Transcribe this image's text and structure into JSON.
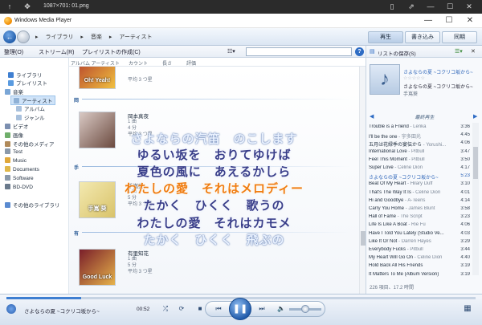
{
  "viewer": {
    "title": "1087×701: 01.png"
  },
  "app": {
    "title": "Windows Media Player",
    "min": "—",
    "max": "☐",
    "close": "✕"
  },
  "nav": {
    "crumbs": [
      "ライブラリ",
      "音楽",
      "アーティスト"
    ],
    "tabs": [
      "再生",
      "書き込み",
      "同期"
    ]
  },
  "toolbar": {
    "organize": "整理(O)",
    "stream": "ストリーム(R)",
    "create_playlist": "プレイリストの作成(C)",
    "search_placeholder": "",
    "help": "?"
  },
  "columns": [
    "アルバム アーティスト",
    "カウント",
    "長さ",
    "評価"
  ],
  "sidebar": [
    {
      "label": "ライブラリ",
      "color": "#3f7fd1"
    },
    {
      "label": "プレイリスト",
      "color": "#5a9be0"
    },
    {
      "label": "音楽",
      "color": "#7aa6d6"
    },
    {
      "label": "アーティスト",
      "color": "#8fb1d6",
      "selected": true
    },
    {
      "label": "アルバム",
      "color": "#a9c1dd"
    },
    {
      "label": "ジャンル",
      "color": "#a9c1dd"
    },
    {
      "label": "ビデオ",
      "color": "#7b8fb0"
    },
    {
      "label": "画像",
      "color": "#6fae6a"
    },
    {
      "label": "その他のメディア",
      "color": "#b08a5a"
    },
    {
      "label": "Test",
      "color": "#8a99aa"
    },
    {
      "label": "Music",
      "color": "#e0a83a"
    },
    {
      "label": "Documents",
      "color": "#e0b84a"
    },
    {
      "label": "Software",
      "color": "#8a99aa"
    },
    {
      "label": "BD-DVD",
      "color": "#6a7a8c"
    },
    {
      "label": "その他のライブラリ",
      "color": "#5a8ad0"
    }
  ],
  "artists": [
    {
      "name": "",
      "meta1": "平均 3 つ星",
      "meta2": "",
      "meta3": "",
      "colors": [
        "#b23a2a",
        "#f0c040"
      ],
      "text": "Oh! Yeah!"
    },
    {
      "name": "岡本真夜",
      "meta1": "1 曲",
      "meta2": "4 分",
      "meta3": "平均 3 つ星",
      "colors": [
        "#d9c9c4",
        "#6b4a3f"
      ],
      "text": ""
    },
    {
      "name": "手嶌葵",
      "meta1": "1 曲",
      "meta2": "5 分",
      "meta3": "平均 3 つ星",
      "colors": [
        "#f3e9b0",
        "#d9c36a"
      ],
      "text": "手嶌 葵"
    },
    {
      "name": "有里知花",
      "meta1": "1 曲",
      "meta2": "5 分",
      "meta3": "平均 3 つ星",
      "colors": [
        "#7a1f2a",
        "#e6b24a"
      ],
      "text": "Good Luck"
    }
  ],
  "groups": [
    "岡",
    "手",
    "有"
  ],
  "lyrics": [
    {
      "text": "さよならの汽笛　のこします",
      "style": "faint"
    },
    {
      "text": "ゆるい坂を　おりてゆけば",
      "style": "blue"
    },
    {
      "text": "夏色の風に　あえるかしら",
      "style": "blue"
    },
    {
      "text": "わたしの愛　それはメロディー",
      "style": "orange"
    },
    {
      "text": "たかく　ひくく　歌うの",
      "style": "blue"
    },
    {
      "text": "わたしの愛　それはカモメ",
      "style": "blue"
    },
    {
      "text": "たかく　ひくく　飛ぶの",
      "style": "faint"
    }
  ],
  "rightpane": {
    "save_list": "リストの保存(S)",
    "now_title": "さよならの夏 ~コクリコ坂から~",
    "stars": "☆☆☆☆☆",
    "now_album": "さよならの夏 ~コクリコ坂から~",
    "now_artist": "手嶌葵",
    "list_heading": "最終再生",
    "footer": "226 項目、17.2 時間"
  },
  "playlist": [
    {
      "title": "Trouble is a Friend",
      "artist": "Lenka",
      "dur": "3:36"
    },
    {
      "title": "I'll be the one",
      "artist": "宇多田光",
      "dur": "4:45"
    },
    {
      "title": "五月は花緑季の宴伝から",
      "artist": "Yorushi...",
      "dur": "4:06"
    },
    {
      "title": "International Love",
      "artist": "Pitbull",
      "dur": "3:47"
    },
    {
      "title": "Feel This Moment",
      "artist": "Pitbull",
      "dur": "3:50"
    },
    {
      "title": "Super Love",
      "artist": "Celine Dion",
      "dur": "4:17"
    },
    {
      "title": "さよならの夏 ~コクリコ坂から~",
      "artist": "",
      "dur": "5:23",
      "current": true
    },
    {
      "title": "Beat Of My Heart",
      "artist": "Hilary Duff",
      "dur": "3:10"
    },
    {
      "title": "That's The Way It Is",
      "artist": "Celine Dion",
      "dur": "4:01"
    },
    {
      "title": "Hi and Goodbye",
      "artist": "A-Teens",
      "dur": "4:14"
    },
    {
      "title": "Carry You Home",
      "artist": "James Blunt",
      "dur": "3:58"
    },
    {
      "title": "Hall of Fame",
      "artist": "The Script",
      "dur": "3:23"
    },
    {
      "title": "Life Is Like A Boat",
      "artist": "Rie Fu",
      "dur": "4:06"
    },
    {
      "title": "Have I Told You Lately (Studio Ve...",
      "artist": "",
      "dur": "4:03"
    },
    {
      "title": "Like It Or Not",
      "artist": "Darren Hayes",
      "dur": "3:29"
    },
    {
      "title": "Everybody Fucks",
      "artist": "Pitbull",
      "dur": "3:44"
    },
    {
      "title": "My Heart Will Go On",
      "artist": "Celine Dion",
      "dur": "4:40"
    },
    {
      "title": "Hold Back All His Friends",
      "artist": "",
      "dur": "3:19"
    },
    {
      "title": "It Matters To Me (Album Version)",
      "artist": "",
      "dur": "3:19"
    }
  ],
  "player": {
    "title": "さよならの夏 ~コクリコ坂から~",
    "time": "00:52",
    "progress_pct": 16,
    "volume_pct": 50,
    "shuffle": "⤮",
    "repeat": "⟳",
    "stop": "■",
    "prev": "⏮",
    "pause": "❚❚",
    "next": "⏭",
    "mute": "🔈",
    "layout": "▦"
  }
}
